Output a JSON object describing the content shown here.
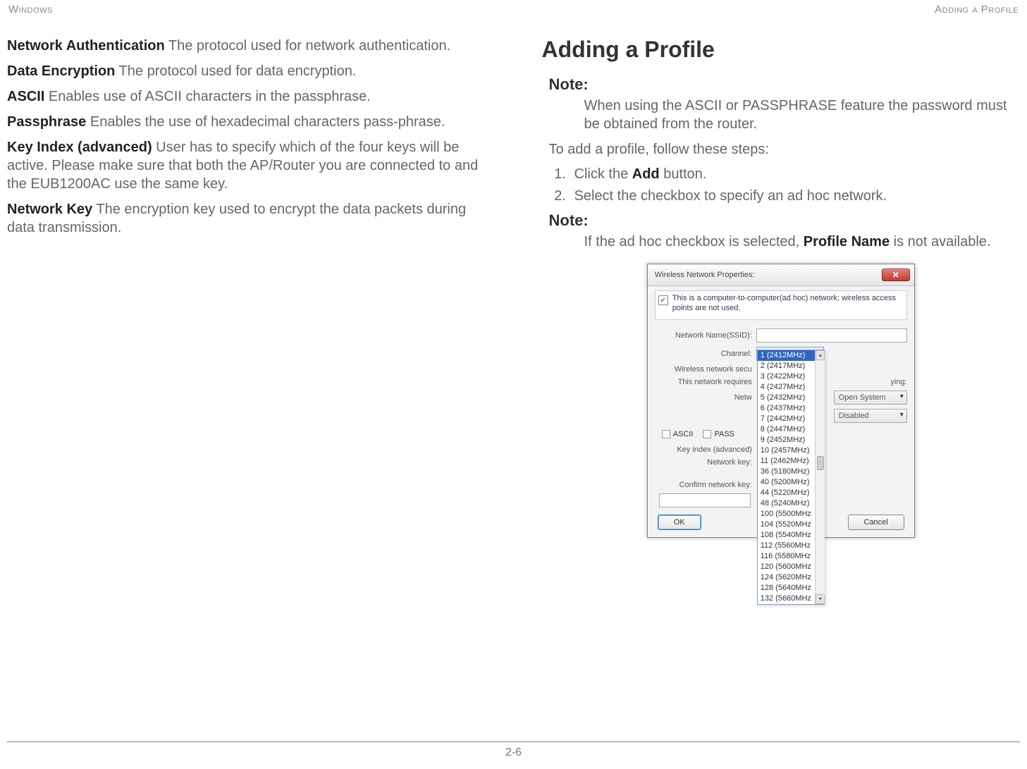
{
  "hdr": {
    "left": "Windows",
    "right": "Adding a Profile"
  },
  "left": {
    "defs": [
      {
        "term": "Network Authentication",
        "desc": "  The protocol used for network authentication."
      },
      {
        "term": "Data Encryption",
        "desc": "  The protocol used for data encryption."
      },
      {
        "term": "ASCII",
        "desc": "  Enables use of ASCII characters in the passphrase."
      },
      {
        "term": "Passphrase",
        "desc": "  Enables the use of hexadecimal characters pass-phrase."
      },
      {
        "term": "Key Index (advanced)",
        "desc": "  User has to specify which of the four keys will be active. Please make sure that both the AP/Router you are connected to and the EUB1200AC use the same key."
      },
      {
        "term": "Network Key",
        "desc": "  The encryption key used to encrypt the data packets during data transmission."
      }
    ]
  },
  "right": {
    "heading": "Adding a Profile",
    "note1_label": "Note:",
    "note1_body": "When using the ASCII or PASSPHRASE feature the password must be obtained from the router.",
    "intro": "To add a profile, follow these steps:",
    "steps": {
      "s1_pre": "Click the ",
      "s1_b": "Add",
      "s1_post": " button.",
      "s2": "Select the checkbox to specify an ad hoc network."
    },
    "note2_label": "Note:",
    "note2_pre": "If the ad hoc checkbox is selected, ",
    "note2_b": "Profile Name",
    "note2_post": " is not available."
  },
  "dialog": {
    "title": "Wireless Network Properties:",
    "adhoc": "This is a computer-to-computer(ad hoc) network; wireless access points are not used.",
    "labels": {
      "ssid": "Network Name(SSID):",
      "channel": "Channel:",
      "sec_hdr": "Wireless network secu",
      "requires": "This network requires",
      "netw": "Netw",
      "ascii": "ASCII",
      "pass": "PASS",
      "keyindex": "Key index (advanced)",
      "netkey": "Network key:",
      "confirm": "Confirm network key:",
      "ying": "ying:"
    },
    "channel_selected": "1  (2412MHz)",
    "auth": "Open System",
    "enc": "Disabled",
    "ok": "OK",
    "cancel": "Cancel",
    "channels": [
      "1  (2412MHz)",
      "2  (2417MHz)",
      "3  (2422MHz)",
      "4  (2427MHz)",
      "5  (2432MHz)",
      "6  (2437MHz)",
      "7  (2442MHz)",
      "8  (2447MHz)",
      "9  (2452MHz)",
      "10 (2457MHz)",
      "11 (2462MHz)",
      "36 (5180MHz)",
      "40 (5200MHz)",
      "44 (5220MHz)",
      "48 (5240MHz)",
      "100 (5500MHz",
      "104 (5520MHz",
      "108 (5540MHz",
      "112 (5560MHz",
      "116 (5580MHz",
      "120 (5600MHz",
      "124 (5620MHz",
      "128 (5640MHz",
      "132 (5660MHz"
    ]
  },
  "pagenum": "2-6"
}
